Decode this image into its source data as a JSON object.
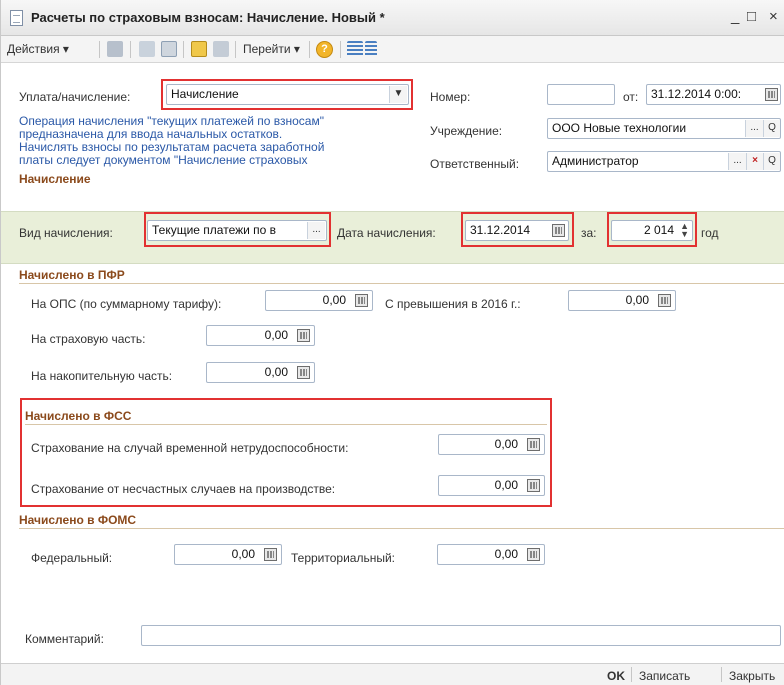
{
  "window": {
    "title": "Расчеты по страховым взносам: Начисление. Новый *",
    "minimize": "_",
    "maximize": "□",
    "close": "×"
  },
  "toolbar": {
    "actions": "Действия ▾",
    "goto": "Перейти ▾",
    "help": "?"
  },
  "form": {
    "payment_label": "Уплата/начисление:",
    "payment_value": "Начисление",
    "info_lines": [
      "Операция начисления \"текущих платежей по взносам\"",
      "предназначена для ввода начальных остатков.",
      "Начислять взносы по результатам расчета заработной",
      "платы следует документом \"Начисление страховых"
    ],
    "number_label": "Номер:",
    "number_value": "",
    "from_label": "от:",
    "date_value": "31.12.2014 0:00:",
    "org_label": "Учреждение:",
    "org_value": "ООО Новые технологии",
    "resp_label": "Ответственный:",
    "resp_value": "Администратор"
  },
  "accrual": {
    "section": "Начисление",
    "type_label": "Вид начисления:",
    "type_value": "Текущие платежи по в",
    "date_label": "Дата начисления:",
    "date_value": "31.12.2014",
    "for_label": "за:",
    "year_value": "2 014",
    "year_suffix": "год"
  },
  "pfr": {
    "section": "Начислено в ПФР",
    "ops_label": "На ОПС (по суммарному тарифу):",
    "ops_value": "0,00",
    "excess_label": "С превышения в 2016 г.:",
    "excess_value": "0,00",
    "insurance_label": "На страховую часть:",
    "insurance_value": "0,00",
    "funded_label": "На накопительную часть:",
    "funded_value": "0,00"
  },
  "fss": {
    "section": "Начислено в ФСС",
    "temp_label": "Страхование на случай временной нетрудоспособности:",
    "temp_value": "0,00",
    "accident_label": "Страхование от несчастных случаев на производстве:",
    "accident_value": "0,00"
  },
  "foms": {
    "section": "Начислено в ФОМС",
    "federal_label": "Федеральный:",
    "federal_value": "0,00",
    "territorial_label": "Территориальный:",
    "territorial_value": "0,00"
  },
  "comment": {
    "label": "Комментарий:",
    "value": ""
  },
  "footer": {
    "ok": "OK",
    "save": "Записать",
    "close": "Закрыть"
  },
  "colors": {
    "section_text": "#8b4a1c",
    "info_text": "#2a58a7",
    "band": "#e9efd9",
    "highlight": "#e23131"
  }
}
